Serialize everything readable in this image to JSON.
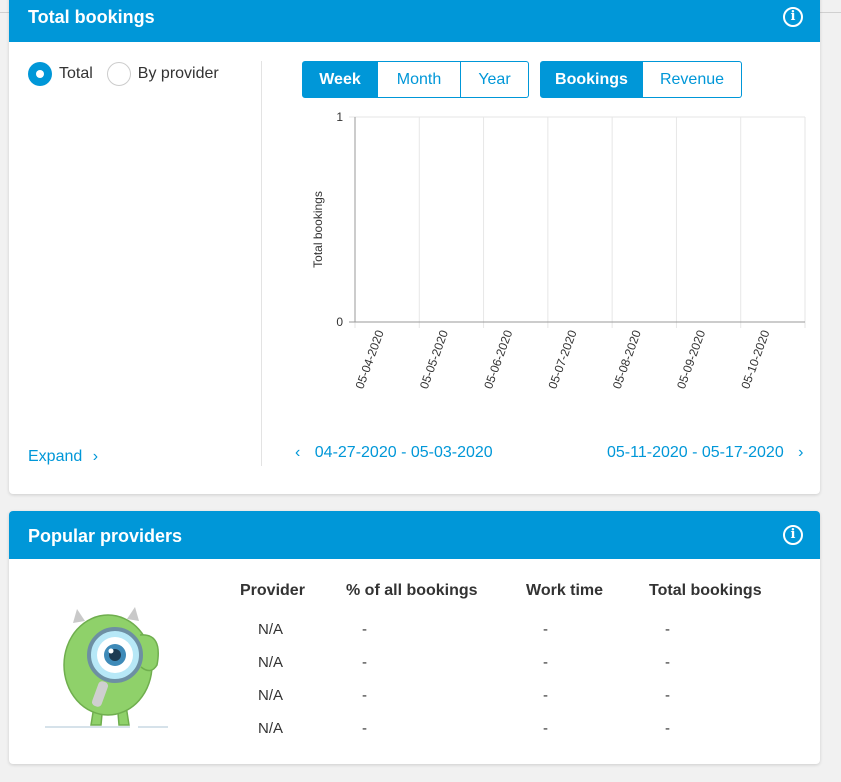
{
  "total_bookings": {
    "title": "Total bookings",
    "info_icon": "info-icon",
    "radio": {
      "total_label": "Total",
      "by_provider_label": "By provider",
      "selected": "Total"
    },
    "period_buttons": [
      "Week",
      "Month",
      "Year"
    ],
    "period_selected": "Week",
    "metric_buttons": [
      "Bookings",
      "Revenue"
    ],
    "metric_selected": "Bookings",
    "expand_label": "Expand",
    "prev_range": "04-27-2020 - 05-03-2020",
    "next_range": "05-11-2020 - 05-17-2020"
  },
  "chart_data": {
    "type": "bar",
    "title": "",
    "xlabel": "",
    "ylabel": "Total bookings",
    "categories": [
      "05-04-2020",
      "05-05-2020",
      "05-06-2020",
      "05-07-2020",
      "05-08-2020",
      "05-09-2020",
      "05-10-2020"
    ],
    "values": [
      0,
      0,
      0,
      0,
      0,
      0,
      0
    ],
    "ylim": [
      0,
      1
    ],
    "yticks": [
      "0",
      "1"
    ],
    "grid": true
  },
  "popular_providers": {
    "title": "Popular providers",
    "info_icon": "info-icon",
    "columns": [
      "Provider",
      "% of all bookings",
      "Work time",
      "Total bookings"
    ],
    "rows": [
      [
        "N/A",
        "-",
        "-",
        "-"
      ],
      [
        "N/A",
        "-",
        "-",
        "-"
      ],
      [
        "N/A",
        "-",
        "-",
        "-"
      ],
      [
        "N/A",
        "-",
        "-",
        "-"
      ]
    ]
  },
  "colors": {
    "accent": "#0097d8",
    "mascot_green": "#8fd16a"
  }
}
